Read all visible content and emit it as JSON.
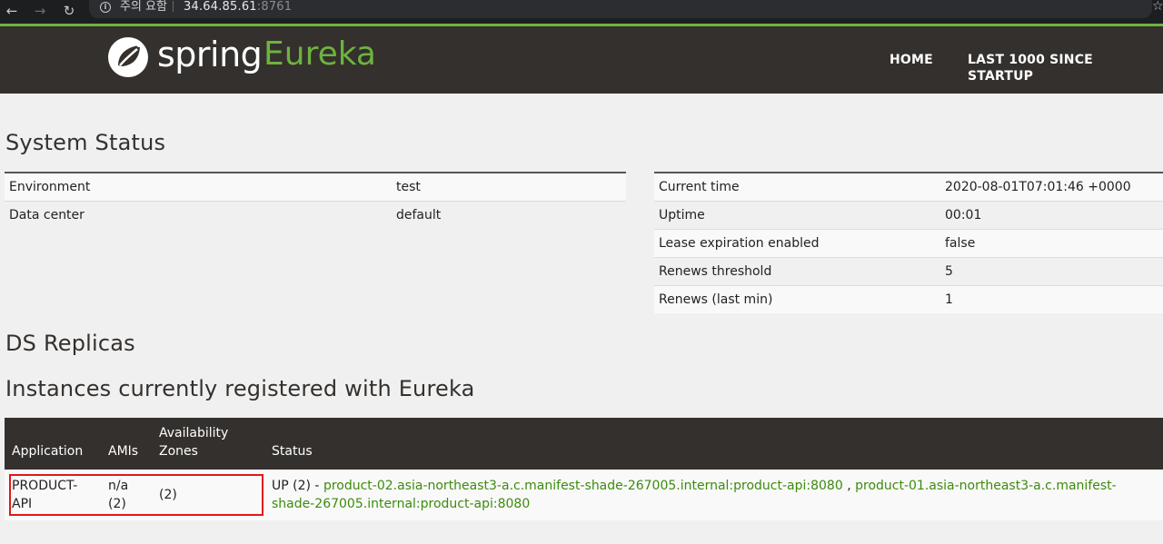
{
  "browser": {
    "back_icon": "←",
    "forward_icon": "→",
    "reload_icon": "↻",
    "security_label": "주의 요함",
    "url_host": "34.64.85.61",
    "url_port": ":8761",
    "star_icon": "☆"
  },
  "header": {
    "logo_spring": "spring",
    "logo_eureka": "Eureka",
    "nav_home": "HOME",
    "nav_last": "LAST 1000 SINCE STARTUP",
    "accent_color": "#6db33f",
    "bg_color": "#34302d"
  },
  "system_status": {
    "title": "System Status",
    "left": [
      {
        "key": "Environment",
        "value": "test"
      },
      {
        "key": "Data center",
        "value": "default"
      }
    ],
    "right": [
      {
        "key": "Current time",
        "value": "2020-08-01T07:01:46 +0000"
      },
      {
        "key": "Uptime",
        "value": "00:01"
      },
      {
        "key": "Lease expiration enabled",
        "value": "false"
      },
      {
        "key": "Renews threshold",
        "value": "5"
      },
      {
        "key": "Renews (last min)",
        "value": "1"
      }
    ]
  },
  "ds_replicas": {
    "title": "DS Replicas"
  },
  "instances": {
    "title": "Instances currently registered with Eureka",
    "columns": [
      "Application",
      "AMIs",
      "Availability Zones",
      "Status"
    ],
    "rows": [
      {
        "application": "PRODUCT-API",
        "amis": "n/a (2)",
        "zones": "(2)",
        "status_prefix": "UP (2) - ",
        "links": [
          "product-02.asia-northeast3-a.c.manifest-shade-267005.internal:product-api:8080",
          "product-01.asia-northeast3-a.c.manifest-shade-267005.internal:product-api:8080"
        ],
        "separator": " , "
      }
    ]
  }
}
